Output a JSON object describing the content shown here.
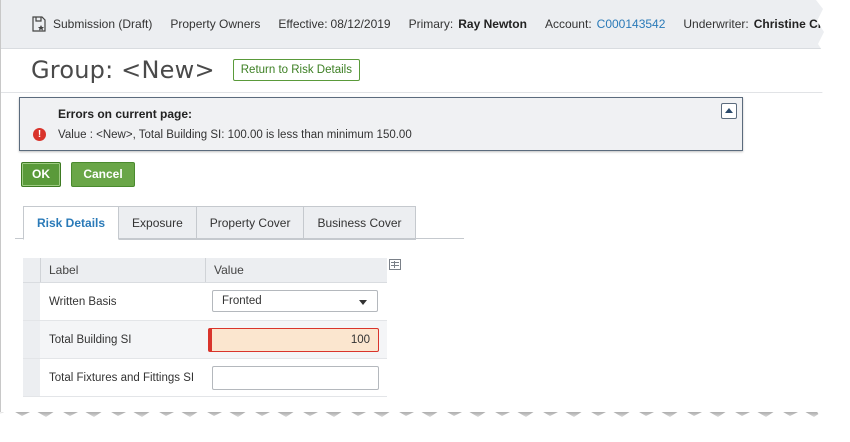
{
  "infobar": {
    "submission": "Submission (Draft)",
    "product": "Property Owners",
    "effective_label": "Effective:",
    "effective_value": "08/12/2019",
    "primary_label": "Primary:",
    "primary_value": "Ray Newton",
    "account_label": "Account:",
    "account_value": "C000143542",
    "underwriter_label": "Underwriter:",
    "underwriter_value": "Christine Craft",
    "icon": "submission-icon"
  },
  "header": {
    "title": "Group: <New>",
    "return_button": "Return to Risk Details"
  },
  "errors": {
    "title": "Errors on current page:",
    "messages": [
      "Value : <New>, Total Building SI: 100.00 is less than minimum 150.00"
    ],
    "icon": "error-icon"
  },
  "actions": {
    "ok": "OK",
    "cancel": "Cancel"
  },
  "tabs": [
    {
      "label": "Risk Details",
      "active": true
    },
    {
      "label": "Exposure",
      "active": false
    },
    {
      "label": "Property Cover",
      "active": false
    },
    {
      "label": "Business Cover",
      "active": false
    }
  ],
  "grid": {
    "columns": [
      "Label",
      "Value"
    ],
    "rows": [
      {
        "label": "Written Basis",
        "value": "Fronted",
        "type": "select"
      },
      {
        "label": "Total Building SI",
        "value": "100",
        "type": "input",
        "error": true
      },
      {
        "label": "Total Fixtures and Fittings SI",
        "value": "",
        "type": "input"
      }
    ]
  },
  "colors": {
    "accent_blue": "#2a7ab8",
    "button_green": "#5a9a3a",
    "error_red": "#d9342b",
    "error_field_bg": "#fbe6cf"
  }
}
